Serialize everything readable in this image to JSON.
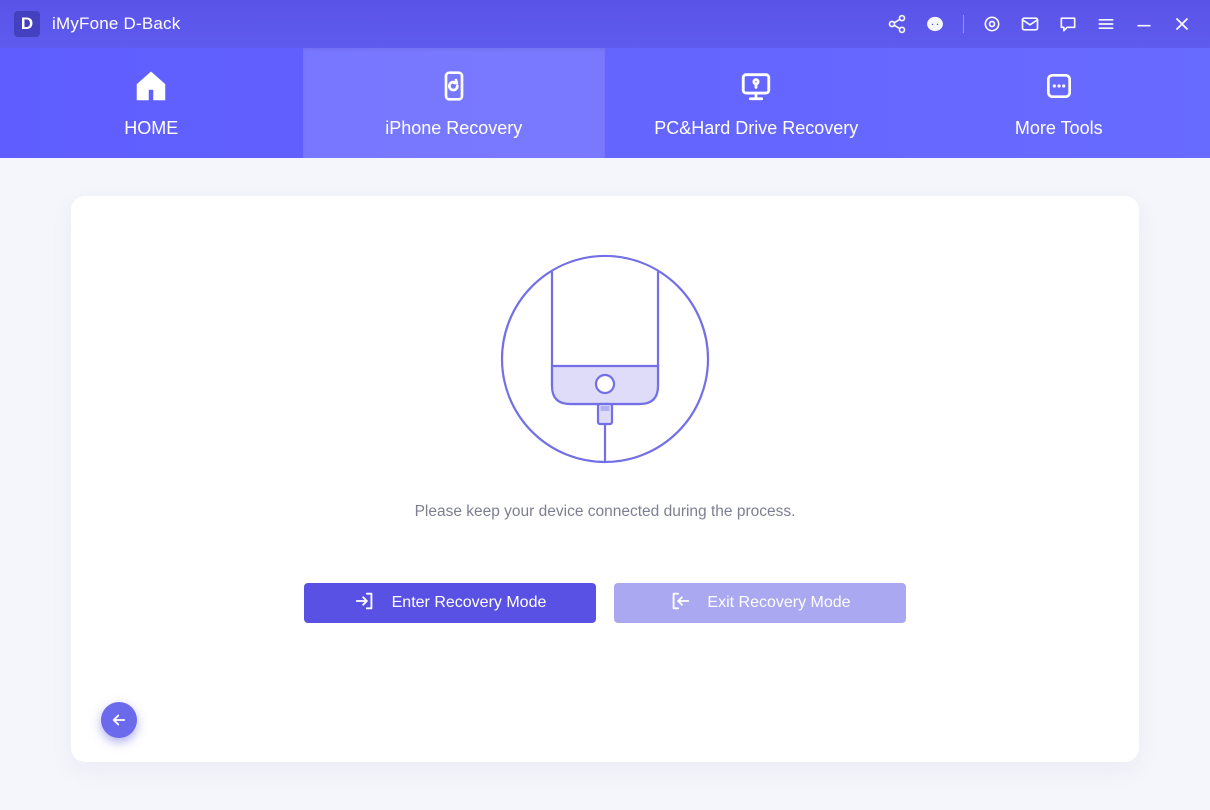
{
  "app": {
    "logo_letter": "D",
    "title": "iMyFone D-Back"
  },
  "tabs": {
    "home": "HOME",
    "iphone": "iPhone Recovery",
    "pc": "PC&Hard Drive Recovery",
    "more": "More Tools",
    "active_index": 1
  },
  "main": {
    "instruction": "Please keep your device connected during the process.",
    "enter_button": "Enter Recovery Mode",
    "exit_button": "Exit Recovery Mode"
  },
  "colors": {
    "accent": "#5951e3",
    "accent_light": "#a9a8f0",
    "outline": "#736fe6"
  }
}
